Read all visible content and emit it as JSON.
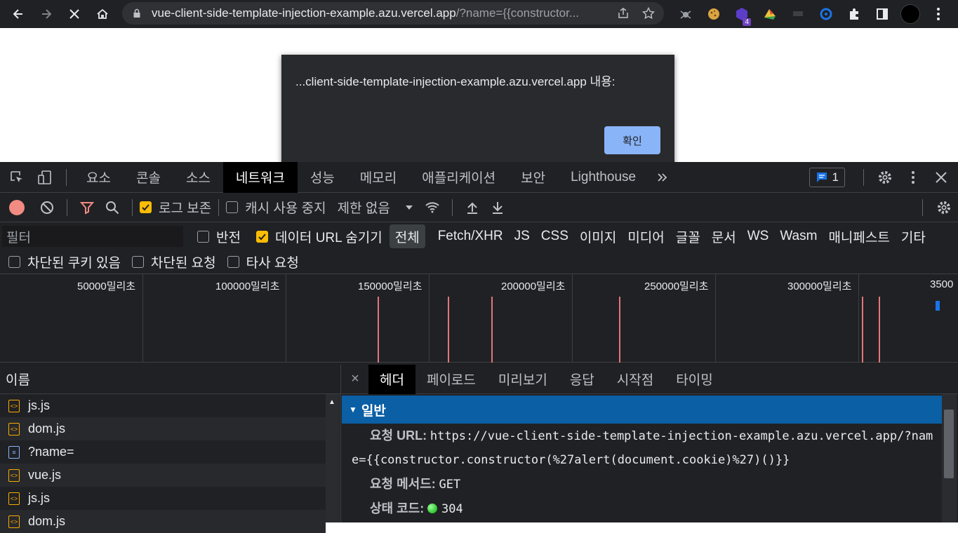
{
  "browser": {
    "url_host": "vue-client-side-template-injection-example.azu.vercel.app",
    "url_path": "/?name={{constructor...",
    "extension_badge": "4"
  },
  "dialog": {
    "title": "...client-side-template-injection-example.azu.vercel.app 내용:",
    "ok_label": "확인"
  },
  "devtools": {
    "tabs": [
      "요소",
      "콘솔",
      "소스",
      "네트워크",
      "성능",
      "메모리",
      "애플리케이션",
      "보안",
      "Lighthouse"
    ],
    "active_tab": "네트워크",
    "issues_count": "1",
    "network": {
      "preserve_log": "로그 보존",
      "disable_cache": "캐시 사용 중지",
      "throttle": "제한 없음"
    },
    "filter": {
      "placeholder": "필터",
      "invert": "반전",
      "hide_data_urls": "데이터 URL 숨기기",
      "types": [
        "전체",
        "Fetch/XHR",
        "JS",
        "CSS",
        "이미지",
        "미디어",
        "글꼴",
        "문서",
        "WS",
        "Wasm",
        "매니페스트",
        "기타"
      ],
      "blocked_cookies": "차단된 쿠키 있음",
      "blocked_requests": "차단된 요청",
      "third_party": "타사 요청"
    },
    "overview_ticks": [
      "50000밀리초",
      "100000밀리초",
      "150000밀리초",
      "200000밀리초",
      "250000밀리초",
      "300000밀리초",
      "3500"
    ],
    "requests": {
      "header": "이름",
      "rows": [
        {
          "name": "js.js",
          "type": "script"
        },
        {
          "name": "dom.js",
          "type": "script"
        },
        {
          "name": "?name=",
          "type": "document"
        },
        {
          "name": "vue.js",
          "type": "script"
        },
        {
          "name": "js.js",
          "type": "script"
        },
        {
          "name": "dom.js",
          "type": "script"
        }
      ]
    },
    "detail": {
      "tabs": [
        "헤더",
        "페이로드",
        "미리보기",
        "응답",
        "시작점",
        "타이밍"
      ],
      "section": "일반",
      "request_url_label": "요청 URL:",
      "request_url_line1": "https://vue-client-side-template-injection-example.azu.vercel.app/?nam",
      "request_url_line2": "e={{constructor.constructor(%27alert(document.cookie)%27)()}}",
      "method_label": "요청 메서드:",
      "method_value": "GET",
      "status_label": "상태 코드:",
      "status_value": "304"
    }
  }
}
